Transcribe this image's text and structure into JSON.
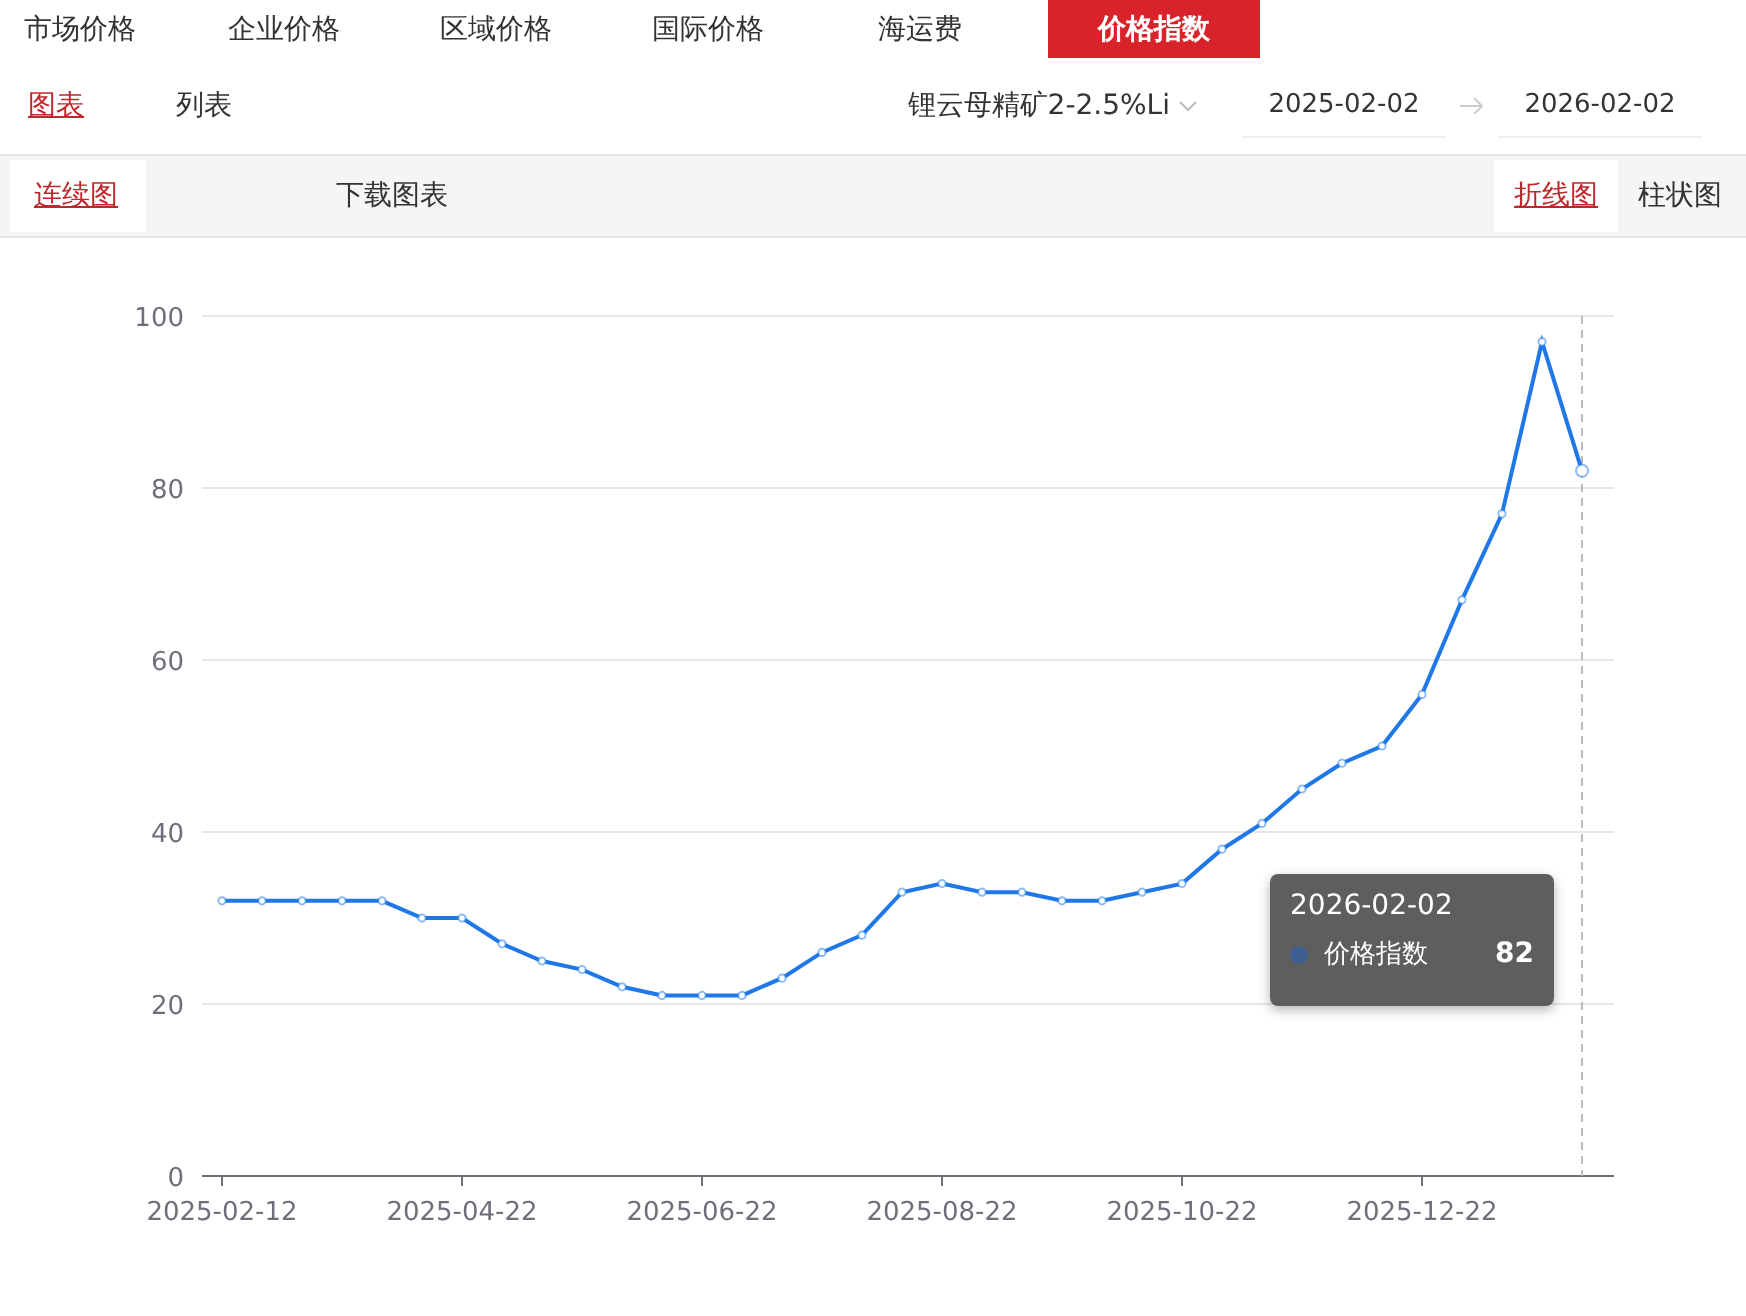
{
  "tabs": [
    {
      "label": "市场价格",
      "selected": false
    },
    {
      "label": "企业价格",
      "selected": false
    },
    {
      "label": "区域价格",
      "selected": false
    },
    {
      "label": "国际价格",
      "selected": false
    },
    {
      "label": "海运费",
      "selected": false
    },
    {
      "label": "价格指数",
      "selected": true
    }
  ],
  "view_tabs": [
    {
      "label": "图表",
      "selected": true
    },
    {
      "label": "列表",
      "selected": false
    }
  ],
  "product_select": {
    "value": "锂云母精矿2-2.5%Li"
  },
  "date_range": {
    "start": "2025-02-02",
    "end": "2026-02-02"
  },
  "toolbar": {
    "left": [
      {
        "label": "连续图",
        "selected": true
      }
    ],
    "download": "下载图表",
    "chart_types": [
      {
        "label": "折线图",
        "selected": true
      },
      {
        "label": "柱状图",
        "selected": false
      }
    ]
  },
  "chart": {
    "chart_data": {
      "type": "line",
      "categories": [
        "2025-02-12",
        null,
        null,
        null,
        null,
        null,
        "2025-04-22",
        null,
        null,
        null,
        null,
        null,
        "2025-06-22",
        null,
        null,
        null,
        null,
        null,
        "2025-08-22",
        null,
        null,
        null,
        null,
        null,
        "2025-10-22",
        null,
        null,
        null,
        null,
        null,
        "2025-12-22",
        null,
        null,
        null,
        null
      ],
      "grid": true,
      "series": [
        {
          "name": "价格指数",
          "color": "#1f77e8",
          "marker": true,
          "values": [
            32,
            32,
            32,
            32,
            32,
            30,
            30,
            27,
            25,
            24,
            22,
            21,
            21,
            21,
            23,
            26,
            28,
            33,
            34,
            33,
            33,
            32,
            32,
            33,
            34,
            38,
            41,
            45,
            48,
            50,
            56,
            67,
            77,
            97,
            82
          ]
        }
      ],
      "ylim": [
        0,
        100
      ],
      "yticks": [
        0,
        20,
        40,
        60,
        80,
        100
      ]
    },
    "tooltip": {
      "title": "2026-02-02",
      "value": "82",
      "color": "#3d5f92"
    }
  }
}
